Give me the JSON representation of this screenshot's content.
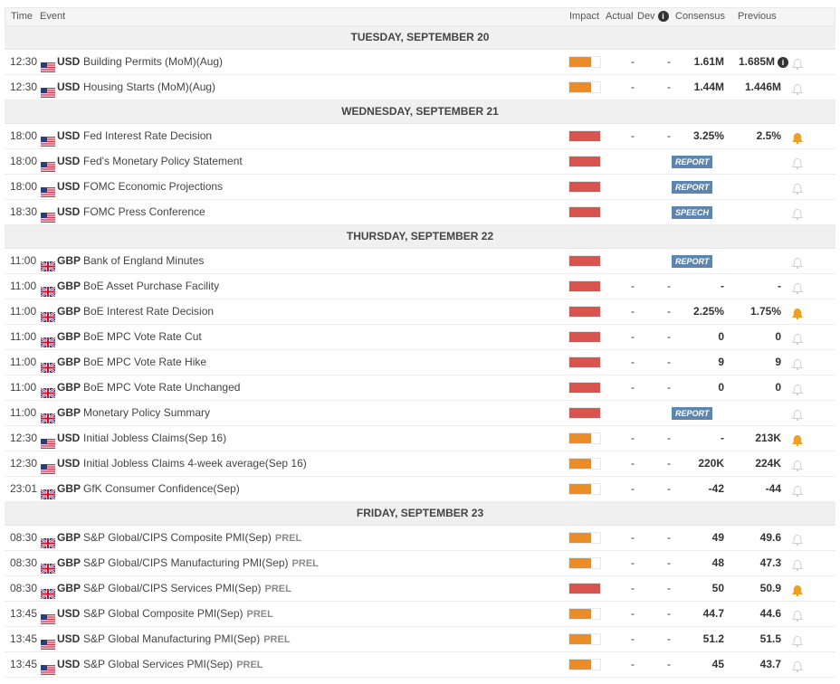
{
  "columns": {
    "time": "Time",
    "event": "Event",
    "impact": "Impact",
    "actual": "Actual",
    "dev": "Dev",
    "consensus": "Consensus",
    "previous": "Previous"
  },
  "colors": {
    "medium": "#ea8d29",
    "high": "#d9534f",
    "tag": "#5e85ad",
    "bell_active": "#f0a020",
    "bell_inactive": "#d0d0d0"
  },
  "days": [
    {
      "label": "TUESDAY, SEPTEMBER 20",
      "events": [
        {
          "time": "12:30",
          "flag": "us",
          "currency": "USD",
          "name": "Building Permits (MoM)(Aug)",
          "impact": "med",
          "actual": "-",
          "dev": "-",
          "consensus": "1.61M",
          "previous": "1.685M",
          "prev_info": true,
          "alert": false
        },
        {
          "time": "12:30",
          "flag": "us",
          "currency": "USD",
          "name": "Housing Starts (MoM)(Aug)",
          "impact": "med",
          "actual": "-",
          "dev": "-",
          "consensus": "1.44M",
          "previous": "1.446M",
          "alert": false
        }
      ]
    },
    {
      "label": "WEDNESDAY, SEPTEMBER 21",
      "events": [
        {
          "time": "18:00",
          "flag": "us",
          "currency": "USD",
          "name": "Fed Interest Rate Decision",
          "impact": "high",
          "actual": "-",
          "dev": "-",
          "consensus": "3.25%",
          "previous": "2.5%",
          "alert": true
        },
        {
          "time": "18:00",
          "flag": "us",
          "currency": "USD",
          "name": "Fed's Monetary Policy Statement",
          "impact": "high",
          "tag": "REPORT",
          "alert": false
        },
        {
          "time": "18:00",
          "flag": "us",
          "currency": "USD",
          "name": "FOMC Economic Projections",
          "impact": "high",
          "tag": "REPORT",
          "alert": false
        },
        {
          "time": "18:30",
          "flag": "us",
          "currency": "USD",
          "name": "FOMC Press Conference",
          "impact": "high",
          "tag": "SPEECH",
          "alert": false
        }
      ]
    },
    {
      "label": "THURSDAY, SEPTEMBER 22",
      "events": [
        {
          "time": "11:00",
          "flag": "gb",
          "currency": "GBP",
          "name": "Bank of England Minutes",
          "impact": "high",
          "tag": "REPORT",
          "alert": false
        },
        {
          "time": "11:00",
          "flag": "gb",
          "currency": "GBP",
          "name": "BoE Asset Purchase Facility",
          "impact": "high",
          "actual": "-",
          "dev": "-",
          "consensus": "-",
          "previous": "-",
          "alert": false
        },
        {
          "time": "11:00",
          "flag": "gb",
          "currency": "GBP",
          "name": "BoE Interest Rate Decision",
          "impact": "high",
          "actual": "-",
          "dev": "-",
          "consensus": "2.25%",
          "previous": "1.75%",
          "alert": true
        },
        {
          "time": "11:00",
          "flag": "gb",
          "currency": "GBP",
          "name": "BoE MPC Vote Rate Cut",
          "impact": "high",
          "actual": "-",
          "dev": "-",
          "consensus": "0",
          "previous": "0",
          "alert": false
        },
        {
          "time": "11:00",
          "flag": "gb",
          "currency": "GBP",
          "name": "BoE MPC Vote Rate Hike",
          "impact": "high",
          "actual": "-",
          "dev": "-",
          "consensus": "9",
          "previous": "9",
          "alert": false
        },
        {
          "time": "11:00",
          "flag": "gb",
          "currency": "GBP",
          "name": "BoE MPC Vote Rate Unchanged",
          "impact": "high",
          "actual": "-",
          "dev": "-",
          "consensus": "0",
          "previous": "0",
          "alert": false
        },
        {
          "time": "11:00",
          "flag": "gb",
          "currency": "GBP",
          "name": "Monetary Policy Summary",
          "impact": "high",
          "tag": "REPORT",
          "alert": false
        },
        {
          "time": "12:30",
          "flag": "us",
          "currency": "USD",
          "name": "Initial Jobless Claims(Sep 16)",
          "impact": "med",
          "actual": "-",
          "dev": "-",
          "consensus": "-",
          "previous": "213K",
          "alert": true
        },
        {
          "time": "12:30",
          "flag": "us",
          "currency": "USD",
          "name": "Initial Jobless Claims 4-week average(Sep 16)",
          "impact": "med",
          "actual": "-",
          "dev": "-",
          "consensus": "220K",
          "previous": "224K",
          "alert": false
        },
        {
          "time": "23:01",
          "flag": "gb",
          "currency": "GBP",
          "name": "GfK Consumer Confidence(Sep)",
          "impact": "med",
          "actual": "-",
          "dev": "-",
          "consensus": "-42",
          "previous": "-44",
          "alert": false
        }
      ]
    },
    {
      "label": "FRIDAY, SEPTEMBER 23",
      "events": [
        {
          "time": "08:30",
          "flag": "gb",
          "currency": "GBP",
          "name": "S&P Global/CIPS Composite PMI(Sep)",
          "prel": "PREL",
          "impact": "med",
          "actual": "-",
          "dev": "-",
          "consensus": "49",
          "previous": "49.6",
          "alert": false
        },
        {
          "time": "08:30",
          "flag": "gb",
          "currency": "GBP",
          "name": "S&P Global/CIPS Manufacturing PMI(Sep)",
          "prel": "PREL",
          "impact": "med",
          "actual": "-",
          "dev": "-",
          "consensus": "48",
          "previous": "47.3",
          "alert": false
        },
        {
          "time": "08:30",
          "flag": "gb",
          "currency": "GBP",
          "name": "S&P Global/CIPS Services PMI(Sep)",
          "prel": "PREL",
          "impact": "high",
          "actual": "-",
          "dev": "-",
          "consensus": "50",
          "previous": "50.9",
          "alert": true
        },
        {
          "time": "13:45",
          "flag": "us",
          "currency": "USD",
          "name": "S&P Global Composite PMI(Sep)",
          "prel": "PREL",
          "impact": "med",
          "actual": "-",
          "dev": "-",
          "consensus": "44.7",
          "previous": "44.6",
          "alert": false
        },
        {
          "time": "13:45",
          "flag": "us",
          "currency": "USD",
          "name": "S&P Global Manufacturing PMI(Sep)",
          "prel": "PREL",
          "impact": "med",
          "actual": "-",
          "dev": "-",
          "consensus": "51.2",
          "previous": "51.5",
          "alert": false
        },
        {
          "time": "13:45",
          "flag": "us",
          "currency": "USD",
          "name": "S&P Global Services PMI(Sep)",
          "prel": "PREL",
          "impact": "med",
          "actual": "-",
          "dev": "-",
          "consensus": "45",
          "previous": "43.7",
          "alert": false
        }
      ]
    }
  ]
}
